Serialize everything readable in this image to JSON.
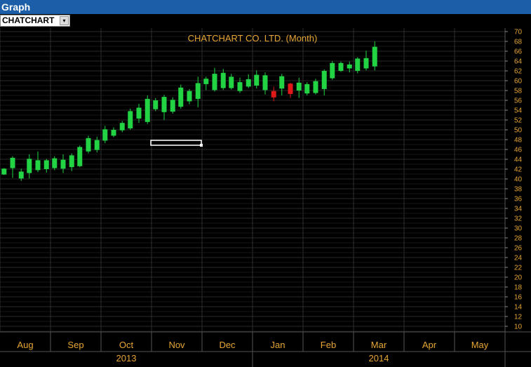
{
  "window": {
    "title": "Graph"
  },
  "symbol_selector": {
    "value": "CHATCHART",
    "arrow": "▾"
  },
  "colors": {
    "background": "#000000",
    "text": "#e6a534",
    "up": "#22d444",
    "down": "#e01818",
    "grid": "#262626"
  },
  "chart_data": {
    "type": "candlestick",
    "title": "CHATCHART CO. LTD. (Month)",
    "ylim": [
      9,
      71
    ],
    "y_ticks": [
      10,
      12,
      14,
      16,
      18,
      20,
      22,
      24,
      26,
      28,
      30,
      32,
      34,
      36,
      38,
      40,
      42,
      44,
      46,
      48,
      50,
      52,
      54,
      56,
      58,
      60,
      62,
      64,
      66,
      68,
      70
    ],
    "grid": true,
    "x_months": [
      "Aug",
      "Sep",
      "Oct",
      "Nov",
      "Dec",
      "Jan",
      "Feb",
      "Mar",
      "Apr",
      "May"
    ],
    "x_years": [
      {
        "label": "2013",
        "start": 0,
        "end": 5
      },
      {
        "label": "2014",
        "start": 5,
        "end": 10
      }
    ],
    "candles": [
      {
        "m": 0.08,
        "o": 40.9,
        "h": 42.2,
        "l": 40.8,
        "c": 42.1,
        "up": true
      },
      {
        "m": 0.25,
        "o": 42.2,
        "h": 44.6,
        "l": 40.2,
        "c": 44.3,
        "up": true
      },
      {
        "m": 0.42,
        "o": 40.1,
        "h": 42.1,
        "l": 39.6,
        "c": 41.5,
        "up": true
      },
      {
        "m": 0.58,
        "o": 41.2,
        "h": 45.0,
        "l": 40.1,
        "c": 44.1,
        "up": true
      },
      {
        "m": 0.75,
        "o": 41.8,
        "h": 45.6,
        "l": 41.4,
        "c": 43.8,
        "up": true
      },
      {
        "m": 0.92,
        "o": 42.0,
        "h": 44.1,
        "l": 41.3,
        "c": 43.8,
        "up": true
      },
      {
        "m": 1.08,
        "o": 42.2,
        "h": 44.6,
        "l": 41.8,
        "c": 44.2,
        "up": true
      },
      {
        "m": 1.25,
        "o": 42.1,
        "h": 45.0,
        "l": 41.2,
        "c": 43.9,
        "up": true
      },
      {
        "m": 1.42,
        "o": 42.4,
        "h": 45.2,
        "l": 41.6,
        "c": 44.8,
        "up": true
      },
      {
        "m": 1.58,
        "o": 42.6,
        "h": 46.8,
        "l": 42.4,
        "c": 46.5,
        "up": true
      },
      {
        "m": 1.75,
        "o": 45.6,
        "h": 48.8,
        "l": 45.2,
        "c": 48.3,
        "up": true
      },
      {
        "m": 1.92,
        "o": 45.9,
        "h": 48.6,
        "l": 45.4,
        "c": 47.9,
        "up": true
      },
      {
        "m": 2.08,
        "o": 47.8,
        "h": 50.8,
        "l": 47.3,
        "c": 50.1,
        "up": true
      },
      {
        "m": 2.25,
        "o": 48.8,
        "h": 50.5,
        "l": 48.5,
        "c": 50.0,
        "up": true
      },
      {
        "m": 2.42,
        "o": 49.9,
        "h": 51.8,
        "l": 49.5,
        "c": 51.4,
        "up": true
      },
      {
        "m": 2.58,
        "o": 50.3,
        "h": 54.3,
        "l": 50.0,
        "c": 53.8,
        "up": true
      },
      {
        "m": 2.75,
        "o": 52.3,
        "h": 55.3,
        "l": 51.4,
        "c": 54.5,
        "up": true
      },
      {
        "m": 2.92,
        "o": 51.6,
        "h": 57.0,
        "l": 51.2,
        "c": 56.3,
        "up": true
      },
      {
        "m": 3.08,
        "o": 54.2,
        "h": 56.5,
        "l": 53.8,
        "c": 56.0,
        "up": true
      },
      {
        "m": 3.25,
        "o": 53.6,
        "h": 57.1,
        "l": 52.0,
        "c": 56.7,
        "up": true
      },
      {
        "m": 3.42,
        "o": 53.7,
        "h": 56.6,
        "l": 53.3,
        "c": 56.1,
        "up": true
      },
      {
        "m": 3.58,
        "o": 54.7,
        "h": 59.2,
        "l": 54.3,
        "c": 58.6,
        "up": true
      },
      {
        "m": 3.75,
        "o": 55.8,
        "h": 58.3,
        "l": 55.2,
        "c": 57.9,
        "up": true
      },
      {
        "m": 3.92,
        "o": 56.3,
        "h": 60.8,
        "l": 54.6,
        "c": 59.5,
        "up": true
      },
      {
        "m": 4.08,
        "o": 59.3,
        "h": 60.8,
        "l": 58.1,
        "c": 60.4,
        "up": true
      },
      {
        "m": 4.25,
        "o": 58.1,
        "h": 62.6,
        "l": 57.8,
        "c": 61.4,
        "up": true
      },
      {
        "m": 4.42,
        "o": 58.5,
        "h": 62.4,
        "l": 58.1,
        "c": 61.6,
        "up": true
      },
      {
        "m": 4.58,
        "o": 58.5,
        "h": 61.4,
        "l": 58.2,
        "c": 60.8,
        "up": true
      },
      {
        "m": 4.75,
        "o": 57.9,
        "h": 60.6,
        "l": 57.5,
        "c": 59.7,
        "up": true
      },
      {
        "m": 4.92,
        "o": 58.8,
        "h": 61.3,
        "l": 58.5,
        "c": 60.3,
        "up": true
      },
      {
        "m": 5.08,
        "o": 59.0,
        "h": 62.1,
        "l": 58.4,
        "c": 61.2,
        "up": true
      },
      {
        "m": 5.25,
        "o": 58.1,
        "h": 61.7,
        "l": 57.2,
        "c": 61.1,
        "up": true
      },
      {
        "m": 5.42,
        "o": 57.9,
        "h": 58.8,
        "l": 55.8,
        "c": 56.6,
        "up": false
      },
      {
        "m": 5.58,
        "o": 58.4,
        "h": 61.4,
        "l": 57.0,
        "c": 60.9,
        "up": true
      },
      {
        "m": 5.75,
        "o": 59.4,
        "h": 59.6,
        "l": 56.5,
        "c": 57.3,
        "up": false
      },
      {
        "m": 5.92,
        "o": 58.0,
        "h": 60.6,
        "l": 56.5,
        "c": 59.6,
        "up": true
      },
      {
        "m": 6.08,
        "o": 57.4,
        "h": 59.7,
        "l": 57.0,
        "c": 59.3,
        "up": true
      },
      {
        "m": 6.25,
        "o": 57.5,
        "h": 60.4,
        "l": 57.2,
        "c": 59.9,
        "up": true
      },
      {
        "m": 6.42,
        "o": 58.3,
        "h": 62.3,
        "l": 57.0,
        "c": 62.0,
        "up": true
      },
      {
        "m": 6.58,
        "o": 60.5,
        "h": 64.0,
        "l": 60.2,
        "c": 63.6,
        "up": true
      },
      {
        "m": 6.75,
        "o": 62.0,
        "h": 63.9,
        "l": 61.8,
        "c": 63.6,
        "up": true
      },
      {
        "m": 6.92,
        "o": 62.5,
        "h": 63.9,
        "l": 61.7,
        "c": 63.3,
        "up": true
      },
      {
        "m": 7.08,
        "o": 62.0,
        "h": 64.8,
        "l": 61.5,
        "c": 64.5,
        "up": true
      },
      {
        "m": 7.25,
        "o": 62.5,
        "h": 66.1,
        "l": 62.1,
        "c": 64.6,
        "up": true
      },
      {
        "m": 7.42,
        "o": 62.9,
        "h": 68.0,
        "l": 62.1,
        "c": 66.9,
        "up": true
      }
    ]
  }
}
